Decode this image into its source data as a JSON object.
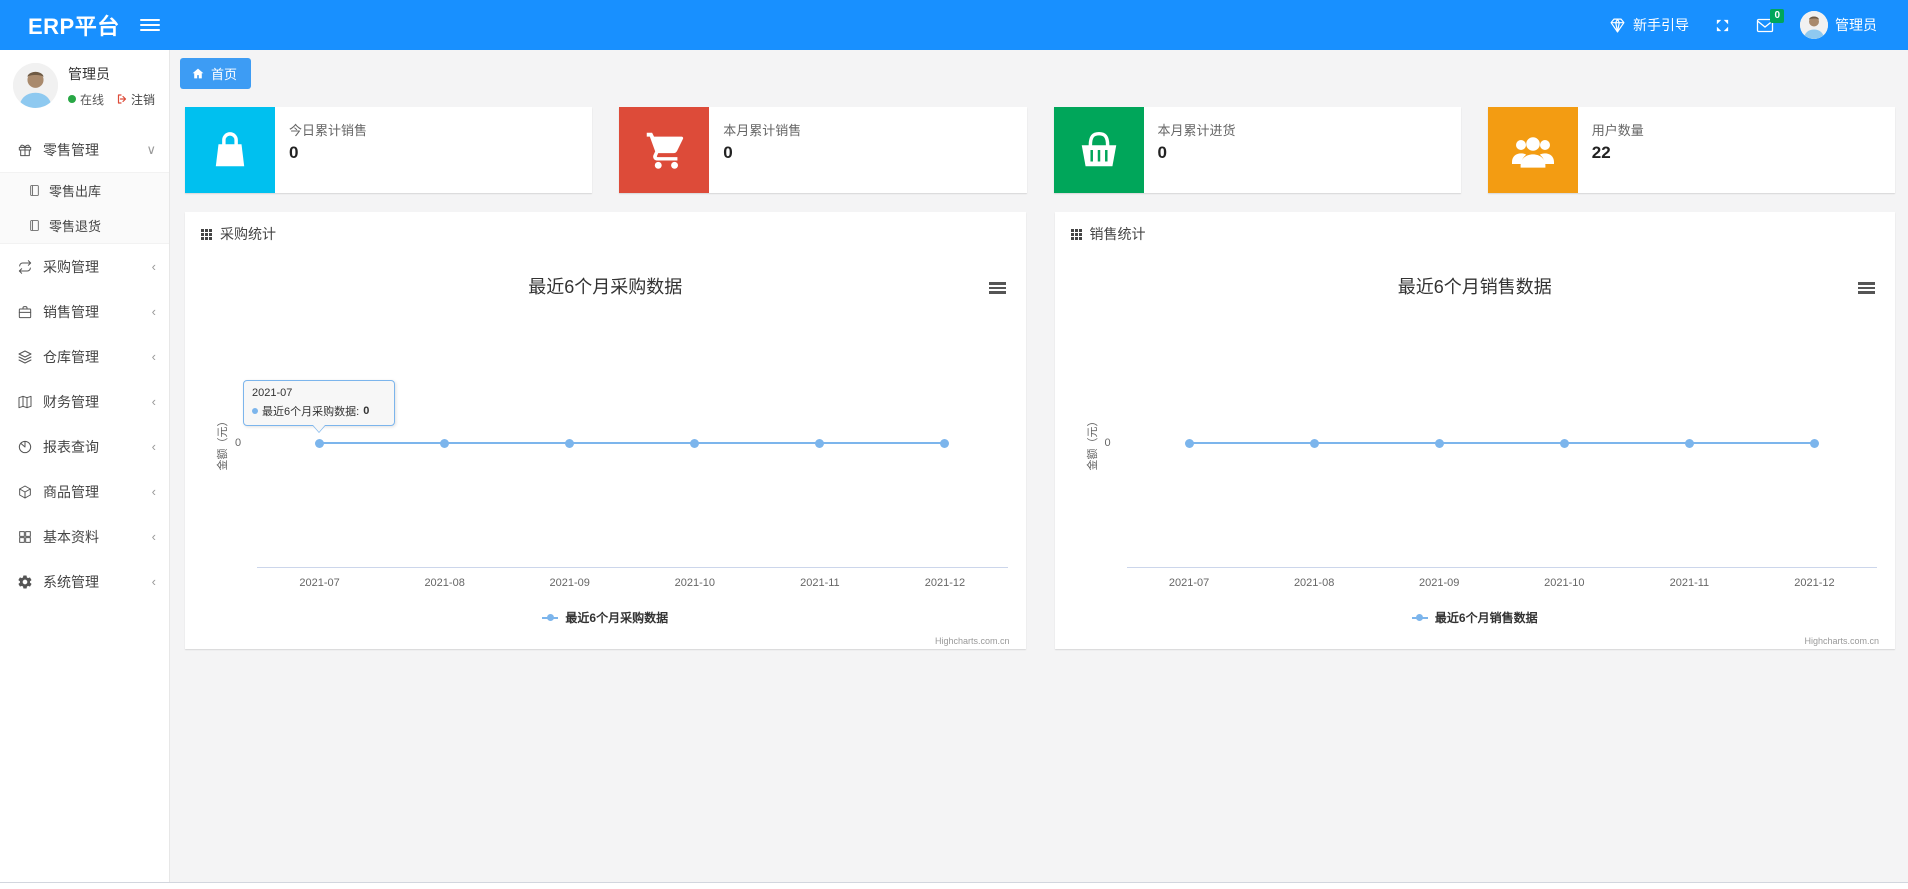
{
  "navbar": {
    "brand": "ERP平台",
    "guide_label": "新手引导",
    "message_badge": "0",
    "user_name": "管理员"
  },
  "sidebar": {
    "user_name": "管理员",
    "status_label": "在线",
    "logout_label": "注销",
    "menu": [
      {
        "label": "零售管理",
        "icon": "gift-icon",
        "expanded": true,
        "children": [
          {
            "label": "零售出库"
          },
          {
            "label": "零售退货"
          }
        ]
      },
      {
        "label": "采购管理",
        "icon": "exchange-icon"
      },
      {
        "label": "销售管理",
        "icon": "briefcase-icon"
      },
      {
        "label": "仓库管理",
        "icon": "layers-icon"
      },
      {
        "label": "财务管理",
        "icon": "book-icon"
      },
      {
        "label": "报表查询",
        "icon": "pie-chart-icon"
      },
      {
        "label": "商品管理",
        "icon": "cube-icon"
      },
      {
        "label": "基本资料",
        "icon": "grid-icon"
      },
      {
        "label": "系统管理",
        "icon": "gear-icon"
      }
    ]
  },
  "icons": {
    "chevron_down": "∨",
    "chevron_left": "‹"
  },
  "breadcrumb": {
    "home_label": "首页"
  },
  "stat_cards": [
    {
      "title": "今日累计销售",
      "value": "0",
      "color": "#00c0ef",
      "icon": "shopping-bag-icon"
    },
    {
      "title": "本月累计销售",
      "value": "0",
      "color": "#dd4b39",
      "icon": "shopping-cart-icon"
    },
    {
      "title": "本月累计进货",
      "value": "0",
      "color": "#00a65a",
      "icon": "shopping-basket-icon"
    },
    {
      "title": "用户数量",
      "value": "22",
      "color": "#f39c12",
      "icon": "users-icon"
    }
  ],
  "panels": [
    {
      "header": "采购统计"
    },
    {
      "header": "销售统计"
    }
  ],
  "chart_data": [
    {
      "type": "line",
      "title": "最近6个月采购数据",
      "categories": [
        "2021-07",
        "2021-08",
        "2021-09",
        "2021-10",
        "2021-11",
        "2021-12"
      ],
      "series": [
        {
          "name": "最近6个月采购数据",
          "values": [
            0,
            0,
            0,
            0,
            0,
            0
          ]
        }
      ],
      "xlabel": "",
      "ylabel": "金额（元）",
      "ytick": "0",
      "ylim": [
        0,
        1
      ],
      "grid": false,
      "legend_position": "bottom",
      "line_color": "#7cb5ec",
      "credits": "Highcharts.com.cn",
      "tooltip": {
        "header": "2021-07",
        "series_label": "最近6个月采购数据:",
        "value": "0"
      }
    },
    {
      "type": "line",
      "title": "最近6个月销售数据",
      "categories": [
        "2021-07",
        "2021-08",
        "2021-09",
        "2021-10",
        "2021-11",
        "2021-12"
      ],
      "series": [
        {
          "name": "最近6个月销售数据",
          "values": [
            0,
            0,
            0,
            0,
            0,
            0
          ]
        }
      ],
      "xlabel": "",
      "ylabel": "金额（元）",
      "ytick": "0",
      "ylim": [
        0,
        1
      ],
      "grid": false,
      "legend_position": "bottom",
      "line_color": "#7cb5ec",
      "credits": "Highcharts.com.cn"
    }
  ]
}
